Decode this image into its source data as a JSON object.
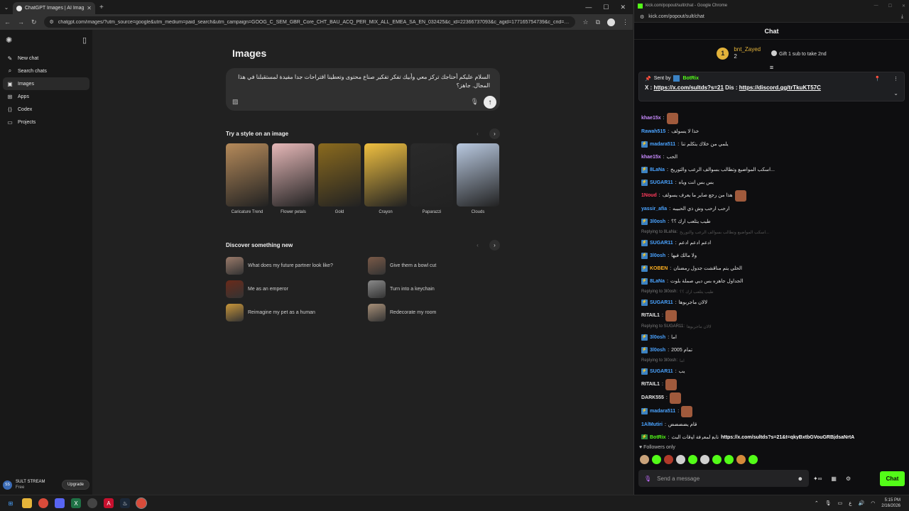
{
  "browser_left": {
    "tab_title": "ChatGPT Images | AI Image Ge",
    "url": "chatgpt.com/images/?utm_source=google&utm_medium=paid_search&utm_campaign=GOOG_C_SEM_GBR_Core_CHT_BAU_ACQ_PER_MIX_ALL_EMEA_SA_EN_032425&c_id=22366737093&c_agid=177165754739&c_crid=744841656..."
  },
  "sidebar": {
    "items": [
      {
        "label": "New chat",
        "icon": "new-chat-icon"
      },
      {
        "label": "Search chats",
        "icon": "search-icon"
      },
      {
        "label": "Images",
        "icon": "image-icon"
      },
      {
        "label": "Apps",
        "icon": "apps-icon"
      },
      {
        "label": "Codex",
        "icon": "codex-icon"
      },
      {
        "label": "Projects",
        "icon": "folder-icon"
      }
    ],
    "active": "Images",
    "user": {
      "initials": "SS",
      "name": "SULT STREAM",
      "plan": "Free"
    },
    "upgrade_label": "Upgrade"
  },
  "main": {
    "title": "Images",
    "prompt_text": "السلام عليكم أحتاجك تركز معي وأبيك تفكر تفكير صناع محتوى وتعطينا اقتراحات جدا مفيدة لمستقبلنا في هذا المجال. جاهز؟",
    "styles_heading": "Try a style on an image",
    "styles": [
      {
        "label": "Caricature Trend",
        "color": "#b58a5a"
      },
      {
        "label": "Flower petals",
        "color": "#e6b8b8"
      },
      {
        "label": "Gold",
        "color": "#8a6a1e"
      },
      {
        "label": "Crayon",
        "color": "#f0c040"
      },
      {
        "label": "Paparazzi",
        "color": "#2a2a2a"
      },
      {
        "label": "Clouds",
        "color": "#b9c9e0"
      }
    ],
    "discover_heading": "Discover something new",
    "discover": [
      {
        "label": "What does my future partner look like?",
        "color": "#9a7a6a"
      },
      {
        "label": "Give them a bowl cut",
        "color": "#7a5a48"
      },
      {
        "label": "Me as an emperor",
        "color": "#6a2a1a"
      },
      {
        "label": "Turn into a keychain",
        "color": "#8a8a8a"
      },
      {
        "label": "Reimagine my pet as a human",
        "color": "#c8963a"
      },
      {
        "label": "Redecorate my room",
        "color": "#a89078"
      }
    ]
  },
  "browser_right": {
    "window_title": "kick.com/popout/sult/chat - Google Chrome",
    "url": "kick.com/popout/sult/chat"
  },
  "chat": {
    "header": "Chat",
    "gift": {
      "rank": "1",
      "user": "bnt_Zayed",
      "count": "2",
      "text": "Gift 1 sub to take 2nd"
    },
    "pinned": {
      "sent_by_label": "Sent by",
      "bot_name": "BotRix",
      "x_label": "X :",
      "x_link": "https://x.com/sultds?s=21",
      "dis_label": "Dis :",
      "dis_link": "https://discord.gg/trTkuKT57C"
    },
    "messages": [
      {
        "type": "msg",
        "user": "khae15x",
        "color": "#c98bff",
        "text": "",
        "emote": true,
        "badge": false
      },
      {
        "type": "msg",
        "user": "Rawah515",
        "color": "#4aa3ff",
        "text": "خذا لا يسولف",
        "badge": false
      },
      {
        "type": "msg",
        "user": "madara511",
        "color": "#4aa3ff",
        "text": "يلمي من خلاك يتكلم تنا",
        "badge": true
      },
      {
        "type": "msg",
        "user": "khae15x",
        "color": "#c98bff",
        "text": "الحب",
        "badge": false
      },
      {
        "type": "msg",
        "user": "8LaNa",
        "color": "#4aa3ff",
        "text": "اسكب المواضيع وتطالب بسوالف الرعب والتوريخ...",
        "badge": true
      },
      {
        "type": "msg",
        "user": "SUGAR11",
        "color": "#4aa3ff",
        "text": "بس بس انت وياه",
        "badge": true
      },
      {
        "type": "msg",
        "user": "1Noud",
        "color": "#ff3b5c",
        "text": "هذا من رجع صاير ما يعرف يسولف",
        "emote": true,
        "badge": false
      },
      {
        "type": "msg",
        "user": "yassir_afia",
        "color": "#4aa3ff",
        "text": "ارحب ارحب وش ذي الحبيبه",
        "badge": false
      },
      {
        "type": "msg",
        "user": "3l0osh",
        "color": "#4aa3ff",
        "text": "طيب يتلعب ارك ؟؟",
        "badge": true
      },
      {
        "type": "reply",
        "target": "Replying to 8LaNa:",
        "text": "اسكب المواضيع وتطالب بسوالف الرعب والتوريخ..."
      },
      {
        "type": "msg",
        "user": "SUGAR11",
        "color": "#4aa3ff",
        "text": "ادعم ادعم ادعم",
        "badge": true
      },
      {
        "type": "msg",
        "user": "3l0osh",
        "color": "#4aa3ff",
        "text": "ولا مالك فيها",
        "badge": true
      },
      {
        "type": "msg",
        "user": "KOBEN",
        "color": "#ffb020",
        "text": "الحلي يتم مناقشت جدول رمضنان",
        "badge": true
      },
      {
        "type": "msg",
        "user": "8LaNa",
        "color": "#4aa3ff",
        "text": "الجداول جاهزه بس ديي صملة بلوت",
        "badge": true
      },
      {
        "type": "reply",
        "target": "Replying to 3l0osh:",
        "text": "طيب يتلعب ارك ؟؟"
      },
      {
        "type": "msg",
        "user": "SUGAR11",
        "color": "#4aa3ff",
        "text": "لالان ماجربوها",
        "badge": true
      },
      {
        "type": "msg",
        "user": "RITAIL1",
        "color": "#e6e6e6",
        "text": "",
        "emote": true,
        "badge": false
      },
      {
        "type": "reply",
        "target": "Replying to SUGAR11:",
        "text": "لالان ماجربوها"
      },
      {
        "type": "msg",
        "user": "3l0osh",
        "color": "#4aa3ff",
        "text": "اما",
        "badge": true
      },
      {
        "type": "msg",
        "user": "3l0osh",
        "color": "#4aa3ff",
        "text": "تمام 2005",
        "badge": true
      },
      {
        "type": "reply",
        "target": "Replying to 3l0osh:",
        "text": "اما"
      },
      {
        "type": "msg",
        "user": "SUGAR11",
        "color": "#4aa3ff",
        "text": "يب",
        "badge": true
      },
      {
        "type": "msg",
        "user": "RITAIL1",
        "color": "#e6e6e6",
        "text": "",
        "emote": true,
        "badge": false
      },
      {
        "type": "msg",
        "user": "DARK555",
        "color": "#e6e6e6",
        "text": "",
        "emote": true,
        "badge": false
      },
      {
        "type": "msg",
        "user": "madara511",
        "color": "#4aa3ff",
        "text": "",
        "emote": true,
        "badge": true
      },
      {
        "type": "msg",
        "user": "1AlMutiri",
        "color": "#4aa3ff",
        "text": "قام يضضضض",
        "badge": false
      },
      {
        "type": "msg",
        "user": "BotRix",
        "color": "#53fc18",
        "text": "تابع لمعرفة اوقات البث",
        "link": "https://x.com/sultds?s=21&t=qkyBxtbGVouGRBjdsaNrtA",
        "badge": true
      }
    ],
    "followers_only": "Followers only",
    "input_placeholder": "Send a message",
    "chat_button": "Chat"
  },
  "taskbar": {
    "time": "5:15 PM",
    "date": "2/16/2026"
  }
}
